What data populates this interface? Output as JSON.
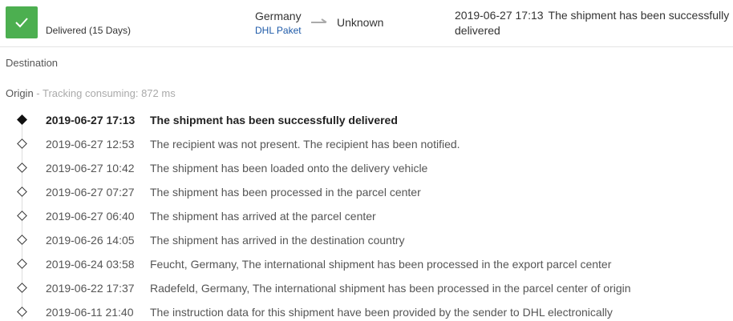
{
  "header": {
    "status_icon": "check-icon",
    "status_color": "#4caf50",
    "status_label": "Delivered (15 Days)",
    "origin_country": "Germany",
    "carrier": "DHL Paket",
    "destination_country": "Unknown",
    "latest_time": "2019-06-27 17:13",
    "latest_desc": "The shipment has been successfully delivered"
  },
  "sections": {
    "destination_label": "Destination",
    "origin_label": "Origin",
    "origin_meta": " - Tracking consuming: 872 ms"
  },
  "events": [
    {
      "time": "2019-06-27 17:13",
      "desc": "The shipment has been successfully delivered"
    },
    {
      "time": "2019-06-27 12:53",
      "desc": "The recipient was not present. The recipient has been notified."
    },
    {
      "time": "2019-06-27 10:42",
      "desc": "The shipment has been loaded onto the delivery vehicle"
    },
    {
      "time": "2019-06-27 07:27",
      "desc": "The shipment has been processed in the parcel center"
    },
    {
      "time": "2019-06-27 06:40",
      "desc": "The shipment has arrived at the parcel center"
    },
    {
      "time": "2019-06-26 14:05",
      "desc": "The shipment has arrived in the destination country"
    },
    {
      "time": "2019-06-24 03:58",
      "desc": "Feucht, Germany, The international shipment has been processed in the export parcel center"
    },
    {
      "time": "2019-06-22 17:37",
      "desc": "Radefeld, Germany, The international shipment has been processed in the parcel center of origin"
    },
    {
      "time": "2019-06-11 21:40",
      "desc": "The instruction data for this shipment have been provided by the sender to DHL electronically"
    }
  ]
}
